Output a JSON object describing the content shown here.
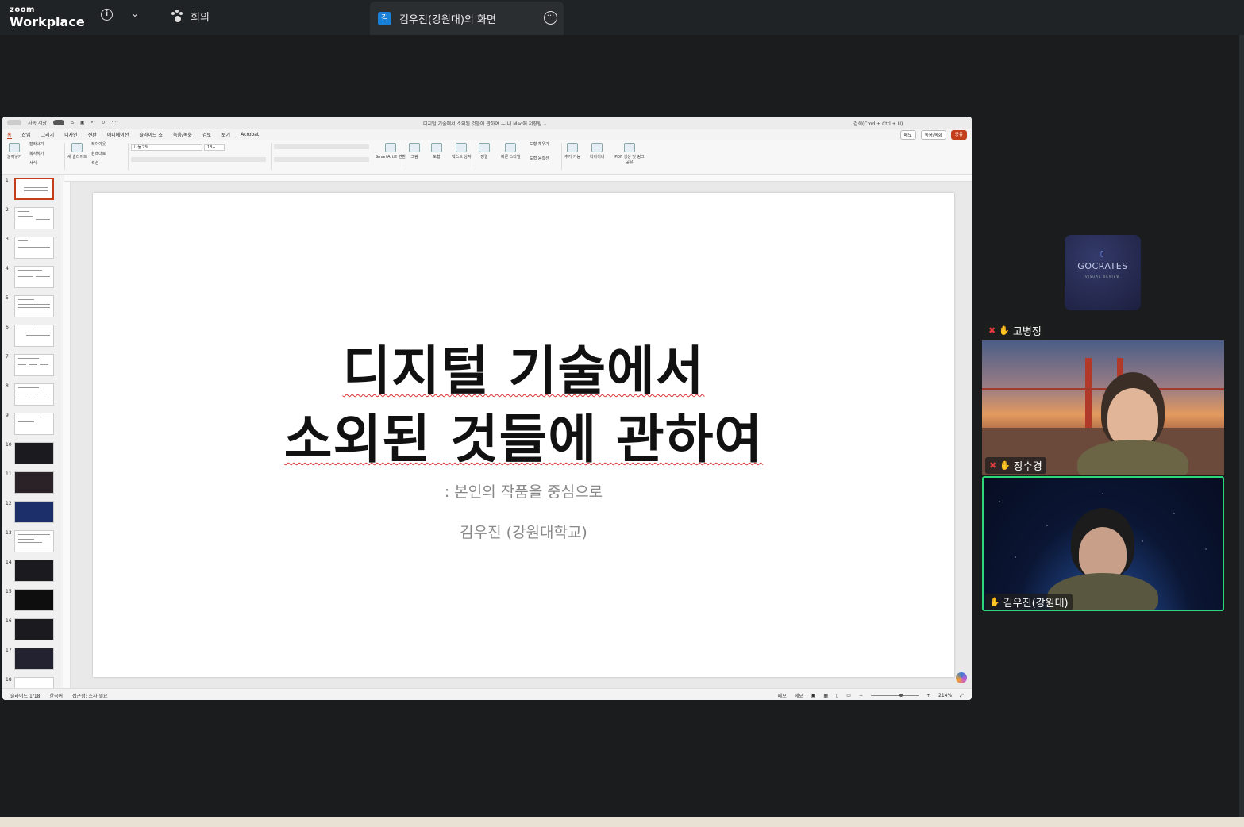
{
  "zoom": {
    "logo_small": "zoom",
    "logo_big": "Workplace",
    "meeting_tab": "회의",
    "share_badge": "김",
    "share_title": "김우진(강원대)의 화면"
  },
  "ppt": {
    "autosave": "자동 저장",
    "doc_title": "디지털 기술에서 소외된 것들에 관하여 — 내 Mac에 저장됨 ⌄",
    "search": "검색(Cmd + Ctrl + U)",
    "menu": [
      "홈",
      "삽입",
      "그리기",
      "디자인",
      "전환",
      "애니메이션",
      "슬라이드 쇼",
      "녹음/녹화",
      "검토",
      "보기",
      "Acrobat"
    ],
    "memo_btn": "메모",
    "record_btn": "녹음/녹화",
    "share_btn": "공유",
    "ribbon": {
      "paste": "붙여넣기",
      "cut": "잘라내기",
      "copy": "복사하기",
      "format": "서식",
      "new_slide": "새 슬라이드",
      "layout": "레이아웃",
      "reset": "원래대로",
      "section": "섹션",
      "font": "나눔고딕",
      "size": "18+",
      "smartart": "SmartArt로 변환",
      "picture": "그림",
      "shape": "도형",
      "textbox": "텍스트 상자",
      "arrange": "정렬",
      "quick_style": "빠른 스타일",
      "shape_fill": "도형 채우기",
      "shape_outline": "도형 윤곽선",
      "addins": "추가 기능",
      "designer": "디자이너",
      "pdf": "PDF 생성 및 링크 공유"
    },
    "thumb_numbers": [
      "1",
      "2",
      "3",
      "4",
      "5",
      "6",
      "7",
      "8",
      "9",
      "10",
      "11",
      "12",
      "13",
      "14",
      "15",
      "16",
      "17",
      "18"
    ],
    "slide": {
      "title_line1": "디지털 기술에서",
      "title_line2": "소외된 것들에 관하여",
      "subtitle": ": 본인의 작품을 중심으로",
      "author": "김우진 (강원대학교)"
    },
    "status": {
      "slide_count": "슬라이드 1/18",
      "language": "한국어",
      "accessibility": "접근성: 조사 필요",
      "notes": "메모",
      "comments": "메모",
      "zoom": "214%"
    }
  },
  "participants": {
    "tile_logo": "GOCRATES",
    "tile_tag": "VISUAL REVIEW",
    "p1": "고병정",
    "p2": "장수경",
    "p3": "김우진(강원대)"
  }
}
